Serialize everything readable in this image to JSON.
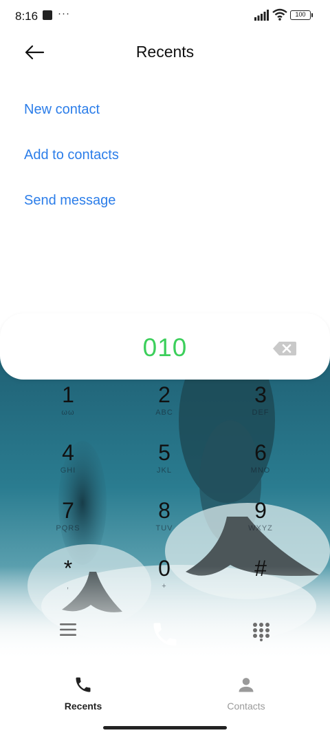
{
  "status_bar": {
    "time": "8:16",
    "dots": "···",
    "battery": "100"
  },
  "header": {
    "title": "Recents"
  },
  "actions": {
    "new_contact": "New contact",
    "add_to_contacts": "Add to contacts",
    "send_message": "Send message"
  },
  "dialer": {
    "number": "010",
    "number_color": "#3ccf5b",
    "keys": [
      {
        "digit": "1",
        "letters": "ωω"
      },
      {
        "digit": "2",
        "letters": "ABC"
      },
      {
        "digit": "3",
        "letters": "DEF"
      },
      {
        "digit": "4",
        "letters": "GHI"
      },
      {
        "digit": "5",
        "letters": "JKL"
      },
      {
        "digit": "6",
        "letters": "MNO"
      },
      {
        "digit": "7",
        "letters": "PQRS"
      },
      {
        "digit": "8",
        "letters": "TUV"
      },
      {
        "digit": "9",
        "letters": "WXYZ"
      },
      {
        "digit": "*",
        "letters": ","
      },
      {
        "digit": "0",
        "letters": "+"
      },
      {
        "digit": "#",
        "letters": ""
      }
    ]
  },
  "bottom_nav": {
    "recents": "Recents",
    "contacts": "Contacts"
  },
  "colors": {
    "accent": "#2b7de9",
    "number": "#3ccf5b"
  }
}
